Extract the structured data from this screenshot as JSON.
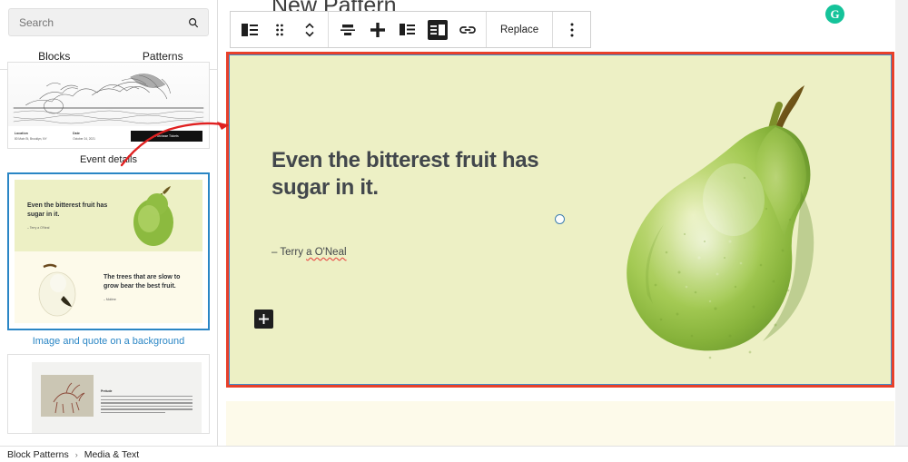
{
  "sidebar": {
    "search": {
      "placeholder": "Search",
      "value": "",
      "icon": "search-icon"
    },
    "tabs": [
      {
        "label": "Blocks",
        "active": false
      },
      {
        "label": "Patterns",
        "active": true
      }
    ],
    "patterns": [
      {
        "label": "Event details",
        "selected": false,
        "meta": [
          {
            "key": "Location",
            "value": "80 Main St, Brooklyn, NY"
          },
          {
            "key": "Date",
            "value": "October 24, 2021"
          }
        ],
        "button": "Purchase Tickets"
      },
      {
        "label": "Image and quote on a background",
        "selected": true,
        "quote_top": "Even the bitterest fruit has sugar in it.",
        "attrib_top": "– Terry a O'Neal",
        "quote_bottom": "The trees that are slow to grow bear the best fruit.",
        "attrib_bottom": "– Molière"
      },
      {
        "label": "",
        "selected": false,
        "heading": "Prelude"
      }
    ]
  },
  "breadcrumb": {
    "items": [
      "Block Patterns",
      "Media & Text"
    ],
    "separator": "›"
  },
  "editor": {
    "document_title": "New Pattern",
    "toolbar": {
      "groups": [
        {
          "buttons": [
            {
              "name": "block-type-media-text-icon",
              "label": "",
              "pressed": false
            },
            {
              "name": "drag-handle-icon",
              "label": "",
              "pressed": false
            },
            {
              "name": "move-up-down-icon",
              "label": "",
              "pressed": false
            }
          ]
        },
        {
          "buttons": [
            {
              "name": "align-vertical-center-icon",
              "label": "",
              "pressed": false
            },
            {
              "name": "align-vertical-stretch-icon",
              "label": "",
              "pressed": false
            },
            {
              "name": "media-on-left-icon",
              "label": "",
              "pressed": false
            },
            {
              "name": "media-on-right-icon",
              "label": "",
              "pressed": true
            },
            {
              "name": "link-icon",
              "label": "",
              "pressed": false
            }
          ]
        },
        {
          "buttons": [
            {
              "name": "replace-button",
              "label": "Replace",
              "pressed": false
            }
          ]
        },
        {
          "buttons": [
            {
              "name": "more-options-icon",
              "label": "",
              "pressed": false
            }
          ]
        }
      ]
    },
    "block": {
      "quote": "Even the bitterest fruit has sugar in it.",
      "attrib_prefix": "– Terry ",
      "attrib_misspelled": "a O'Neal",
      "appender_label": "+",
      "background_color": "#edf0c5",
      "selection_border_color": "#e8402a",
      "inner_border_color": "#3f8cc9"
    },
    "block_below": {
      "background_color": "#fdfaea"
    },
    "resize_handle": {
      "name": "column-resize-handle"
    }
  },
  "overlays": {
    "grammarly_badge": {
      "letter": "G",
      "color": "#15c39a"
    },
    "annotation_arrow": {
      "color": "#e02020"
    }
  }
}
